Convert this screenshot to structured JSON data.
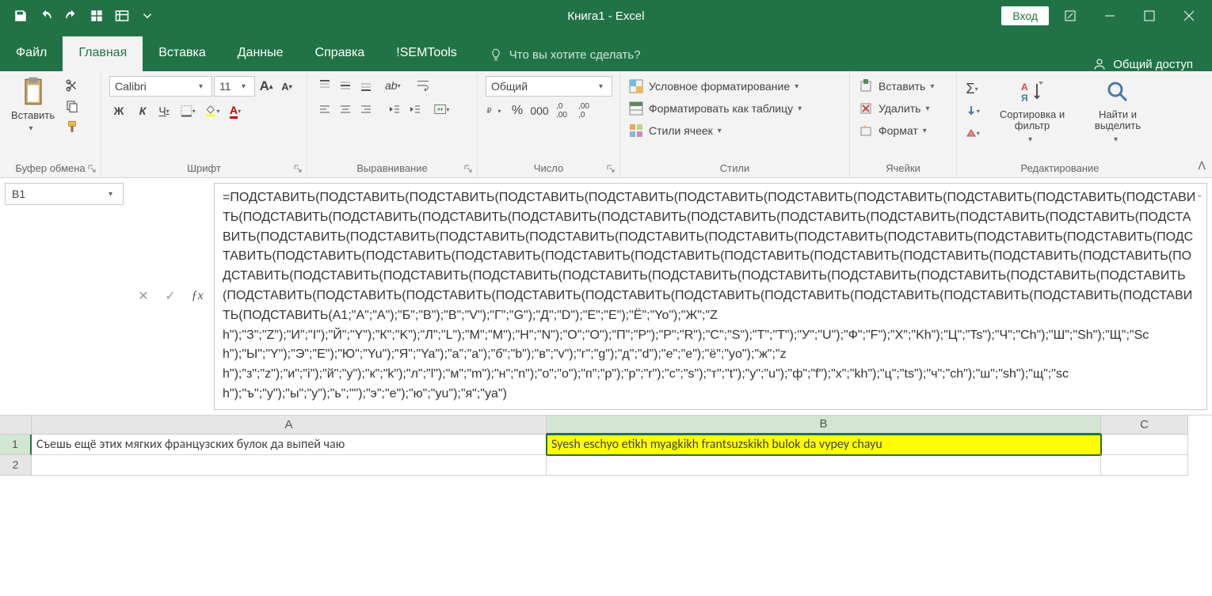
{
  "title": "Книга1  -  Excel",
  "login": "Вход",
  "tabs": {
    "file": "Файл",
    "home": "Главная",
    "insert": "Вставка",
    "data": "Данные",
    "help": "Справка",
    "semtools": "!SEMTools"
  },
  "tellme": "Что вы хотите сделать?",
  "share": "Общий доступ",
  "ribbon": {
    "clipboard": {
      "paste": "Вставить",
      "label": "Буфер обмена"
    },
    "font": {
      "name": "Calibri",
      "size": "11",
      "bold": "Ж",
      "italic": "К",
      "underline": "Ч",
      "label": "Шрифт"
    },
    "align": {
      "wrap": "",
      "merge": "",
      "label": "Выравнивание"
    },
    "number": {
      "format": "Общий",
      "label": "Число"
    },
    "styles": {
      "cond": "Условное форматирование",
      "table": "Форматировать как таблицу",
      "cell": "Стили ячеек",
      "label": "Стили"
    },
    "cells": {
      "ins": "Вставить",
      "del": "Удалить",
      "fmt": "Формат",
      "label": "Ячейки"
    },
    "editing": {
      "sort": "Сортировка и фильтр",
      "find": "Найти и выделить",
      "label": "Редактирование"
    }
  },
  "namebox": "B1",
  "formula": "=ПОДСТАВИТЬ(ПОДСТАВИТЬ(ПОДСТАВИТЬ(ПОДСТАВИТЬ(ПОДСТАВИТЬ(ПОДСТАВИТЬ(ПОДСТАВИТЬ(ПОДСТАВИТЬ(ПОДСТАВИТЬ(ПОДСТАВИТЬ(ПОДСТАВИТЬ(ПОДСТАВИТЬ(ПОДСТАВИТЬ(ПОДСТАВИТЬ(ПОДСТАВИТЬ(ПОДСТАВИТЬ(ПОДСТАВИТЬ(ПОДСТАВИТЬ(ПОДСТАВИТЬ(ПОДСТАВИТЬ(ПОДСТАВИТЬ(ПОДСТАВИТЬ(ПОДСТАВИТЬ(ПОДСТАВИТЬ(ПОДСТАВИТЬ(ПОДСТАВИТЬ(ПОДСТАВИТЬ(ПОДСТАВИТЬ(ПОДСТАВИТЬ(ПОДСТАВИТЬ(ПОДСТАВИТЬ(ПОДСТАВИТЬ(ПОДСТАВИТЬ(ПОДСТАВИТЬ(ПОДСТАВИТЬ(ПОДСТАВИТЬ(ПОДСТАВИТЬ(ПОДСТАВИТЬ(ПОДСТАВИТЬ(ПОДСТАВИТЬ(ПОДСТАВИТЬ(ПОДСТАВИТЬ(ПОДСТАВИТЬ(ПОДСТАВИТЬ(ПОДСТАВИТЬ(ПОДСТАВИТЬ(ПОДСТАВИТЬ(ПОДСТАВИТЬ(ПОДСТАВИТЬ(ПОДСТАВИТЬ(ПОДСТАВИТЬ(ПОДСТАВИТЬ(ПОДСТАВИТЬ(ПОДСТАВИТЬ(ПОДСТАВИТЬ(ПОДСТАВИТЬ(ПОДСТАВИТЬ(ПОДСТАВИТЬ(ПОДСТАВИТЬ(ПОДСТАВИТЬ(ПОДСТАВИТЬ(ПОДСТАВИТЬ(ПОДСТАВИТЬ(ПОДСТАВИТЬ(ПОДСТАВИТЬ(ПОДСТАВИТЬ(A1;\"А\";\"A\");\"Б\";\"B\");\"В\";\"V\");\"Г\";\"G\");\"Д\";\"D\");\"Е\";\"E\");\"Ё\";\"Yo\");\"Ж\";\"Zh\");\"З\";\"Z\");\"И\";\"I\");\"Й\";\"Y\");\"К\";\"K\");\"Л\";\"L\");\"М\";\"M\");\"Н\";\"N\");\"О\";\"O\");\"П\";\"P\");\"Р\";\"R\");\"С\";\"S\");\"Т\";\"T\");\"У\";\"U\");\"Ф\";\"F\");\"Х\";\"Kh\");\"Ц\";\"Ts\");\"Ч\";\"Ch\");\"Ш\";\"Sh\");\"Щ\";\"Sch\");\"Ы\";\"Y\");\"Э\";\"E\");\"Ю\";\"Yu\");\"Я\";\"Ya\");\"а\";\"a\");\"б\";\"b\");\"в\";\"v\");\"г\";\"g\");\"д\";\"d\");\"е\";\"e\");\"ё\";\"yo\");\"ж\";\"zh\");\"з\";\"z\");\"и\";\"i\");\"й\";\"y\");\"к\";\"k\");\"л\";\"l\");\"м\";\"m\");\"н\";\"n\");\"о\";\"o\");\"п\";\"p\");\"р\";\"r\");\"с\";\"s\");\"т\";\"t\");\"у\";\"u\");\"ф\";\"f\");\"х\";\"kh\");\"ц\";\"ts\");\"ч\";\"ch\");\"ш\";\"sh\");\"щ\";\"sch\");\"ъ\";\"y\");\"ы\";\"y\");\"ь\";\"\");\"э\";\"e\");\"ю\";\"yu\");\"я\";\"ya\")",
  "grid": {
    "cols": [
      "A",
      "B",
      "C"
    ],
    "rows": [
      "1",
      "2"
    ],
    "a1": "Съешь ещё этих мягких французских булок да выпей чаю",
    "b1": "Syesh eschyo etikh myagkikh frantsuzskikh bulok da vypey chayu"
  }
}
